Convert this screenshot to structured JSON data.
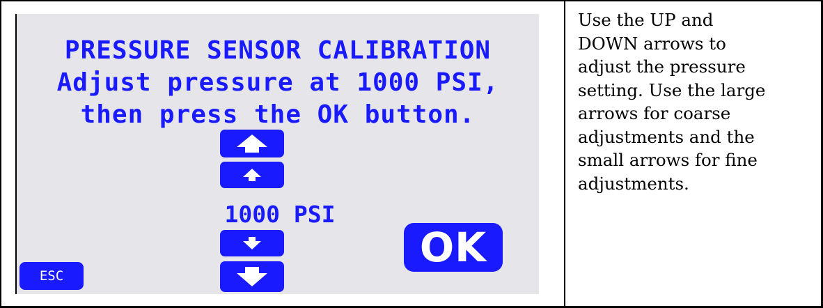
{
  "screen": {
    "title": "PRESSURE SENSOR CALIBRATION",
    "line2": "Adjust pressure at 1000 PSI,",
    "line3": "then press the OK button.",
    "value": "1000 PSI",
    "ok_label": "OK",
    "esc_label": "ESC",
    "accent_color": "#1a1aff",
    "background_color": "#e6e6ea"
  },
  "icons": {
    "up_large": "arrow-up-large-icon",
    "up_small": "arrow-up-small-icon",
    "down_small": "arrow-down-small-icon",
    "down_large": "arrow-down-large-icon"
  },
  "instructions": {
    "lines": [
      "Use the UP and",
      "DOWN arrows to",
      "adjust the pressure",
      "setting. Use the large",
      "arrows for coarse",
      "adjustments and the",
      "small arrows for fine",
      "adjustments."
    ]
  }
}
